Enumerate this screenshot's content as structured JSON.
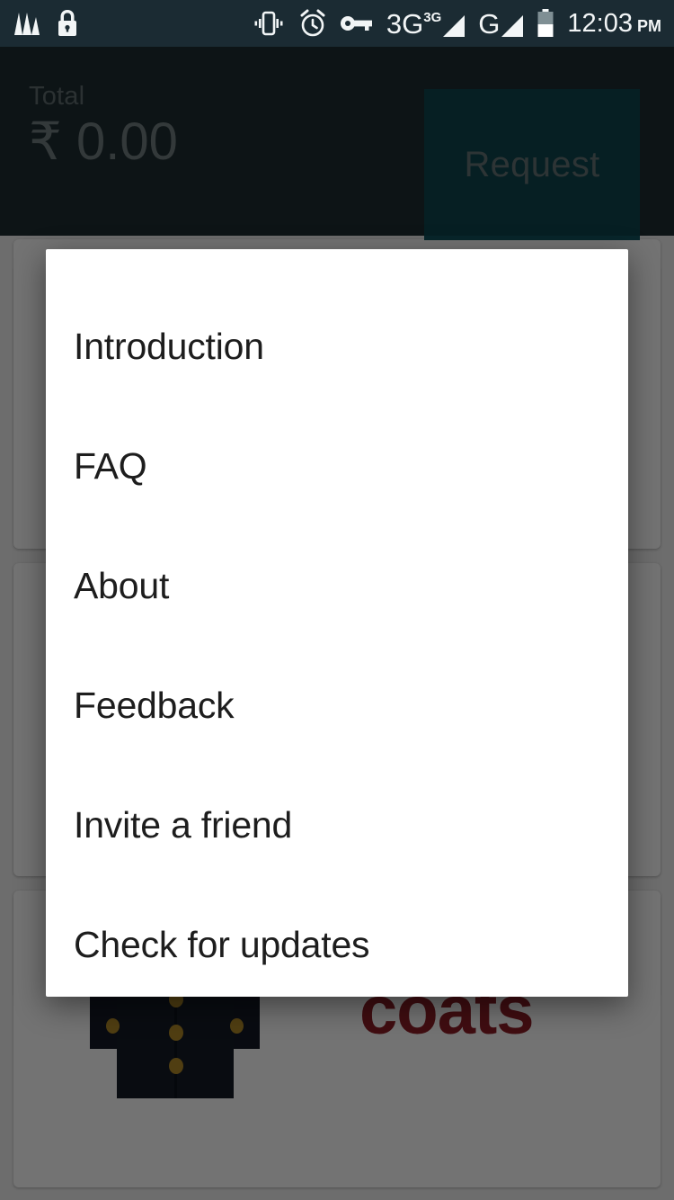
{
  "status_bar": {
    "left_icons": [
      "music-app-icon",
      "lock-icon"
    ],
    "right_icons": [
      "vibrate-icon",
      "alarm-icon",
      "vpn-key-icon",
      "signal-3g-icon",
      "signal-g-icon",
      "battery-icon"
    ],
    "network_1": {
      "label": "3G",
      "superscript": "3G"
    },
    "network_2": {
      "label": "G"
    },
    "battery_level": "50",
    "time": "12:03",
    "meridiem": "PM"
  },
  "app_bar": {
    "total_label": "Total",
    "total_amount": "₹ 0.00",
    "request_label": "Request",
    "background_color": "#25393f",
    "button_color": "#13565f"
  },
  "content": {
    "cards": [
      {
        "name": "promo-card-1",
        "title": "",
        "image": ""
      },
      {
        "name": "promo-card-2",
        "title": "",
        "image": ""
      },
      {
        "name": "promo-card-3",
        "title": "coats",
        "image": "coat-illustration",
        "title_color": "#8e1e27"
      }
    ]
  },
  "dialog": {
    "name": "overflow-menu-dialog",
    "items": [
      {
        "label": "Introduction"
      },
      {
        "label": "FAQ"
      },
      {
        "label": "About"
      },
      {
        "label": "Feedback"
      },
      {
        "label": "Invite a friend"
      },
      {
        "label": "Check for updates"
      }
    ]
  }
}
